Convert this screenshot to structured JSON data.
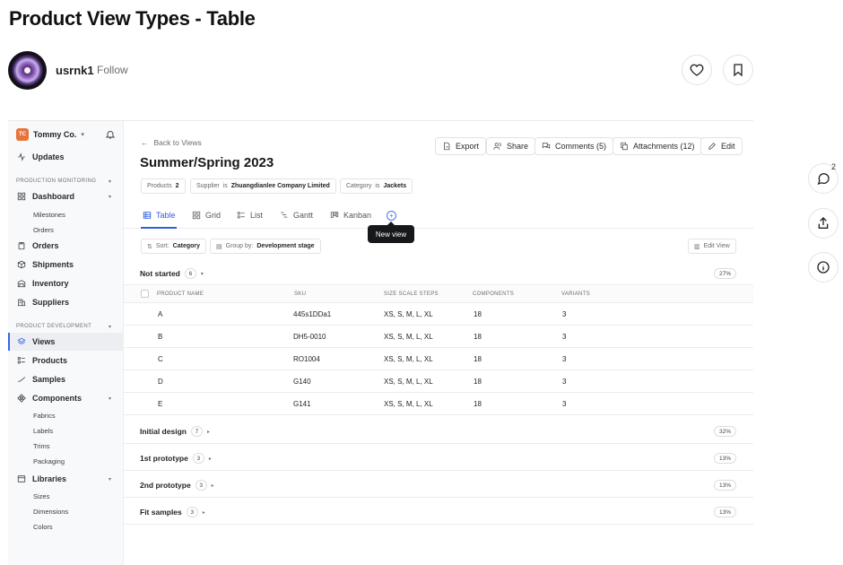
{
  "shot": {
    "title": "Product View Types - Table",
    "author": "usrnk1",
    "follow": "Follow",
    "comment_count": "2"
  },
  "sidebar": {
    "org_initials": "TC",
    "org_name": "Tommy Co.",
    "updates": "Updates",
    "section_monitoring": "PRODUCTION MONITORING",
    "dashboard": "Dashboard",
    "milestones": "Milestones",
    "dash_orders": "Orders",
    "orders": "Orders",
    "shipments": "Shipments",
    "inventory": "Inventory",
    "suppliers": "Suppliers",
    "section_dev": "PRODUCT DEVELOPMENT",
    "views": "Views",
    "products": "Products",
    "samples": "Samples",
    "components": "Components",
    "fabrics": "Fabrics",
    "labels": "Labels",
    "trims": "Trims",
    "packaging": "Packaging",
    "libraries": "Libraries",
    "sizes": "Sizes",
    "dimensions": "Dimensions",
    "colors": "Colors"
  },
  "header": {
    "back": "Back to Views",
    "title": "Summer/Spring 2023",
    "export": "Export",
    "share": "Share",
    "comments": "Comments (5)",
    "attachments": "Attachments (12)",
    "edit": "Edit"
  },
  "chips": {
    "products_key": "Products",
    "products_val": "2",
    "supplier_key": "Supplier",
    "supplier_op": "is",
    "supplier_val": "Zhuangdianlee Company Limited",
    "category_key": "Category",
    "category_op": "is",
    "category_val": "Jackets"
  },
  "tabs": {
    "table": "Table",
    "grid": "Grid",
    "list": "List",
    "gantt": "Gantt",
    "kanban": "Kanban",
    "tooltip": "New view"
  },
  "toolbar": {
    "sort_key": "Sort:",
    "sort_val": "Category",
    "group_key": "Group by:",
    "group_val": "Development stage",
    "edit_view": "Edit View"
  },
  "groups": [
    {
      "label": "Not started",
      "count": "6",
      "pct": "27%"
    },
    {
      "label": "Initial design",
      "count": "7",
      "pct": "32%"
    },
    {
      "label": "1st prototype",
      "count": "3",
      "pct": "13%"
    },
    {
      "label": "2nd prototype",
      "count": "3",
      "pct": "13%"
    },
    {
      "label": "Fit samples",
      "count": "3",
      "pct": "13%"
    }
  ],
  "table": {
    "columns": [
      "PRODUCT NAME",
      "SKU",
      "SIZE SCALE STEPS",
      "COMPONENTS",
      "VARIANTS"
    ],
    "rows": [
      {
        "name": "A",
        "sku": "445s1DDa1",
        "sizes": "XS, S, M, L, XL",
        "components": "18",
        "variants": "3"
      },
      {
        "name": "B",
        "sku": "DH5-0010",
        "sizes": "XS, S, M, L, XL",
        "components": "18",
        "variants": "3"
      },
      {
        "name": "C",
        "sku": "RO1004",
        "sizes": "XS, S, M, L, XL",
        "components": "18",
        "variants": "3"
      },
      {
        "name": "D",
        "sku": "G140",
        "sizes": "XS, S, M, L, XL",
        "components": "18",
        "variants": "3"
      },
      {
        "name": "E",
        "sku": "G141",
        "sizes": "XS, S, M, L, XL",
        "components": "18",
        "variants": "3"
      }
    ]
  }
}
